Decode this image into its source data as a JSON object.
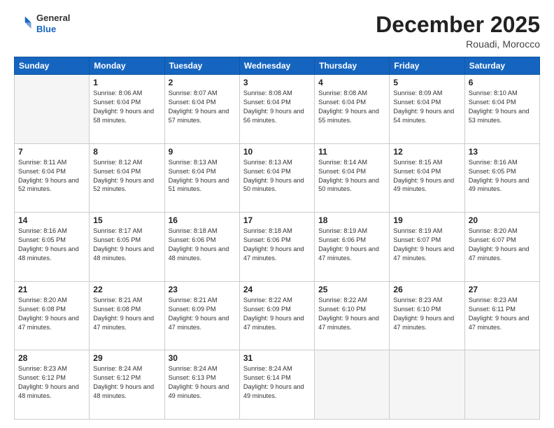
{
  "logo": {
    "general": "General",
    "blue": "Blue"
  },
  "header": {
    "month": "December 2025",
    "location": "Rouadi, Morocco"
  },
  "days_of_week": [
    "Sunday",
    "Monday",
    "Tuesday",
    "Wednesday",
    "Thursday",
    "Friday",
    "Saturday"
  ],
  "weeks": [
    [
      {
        "day": "",
        "empty": true
      },
      {
        "day": "1",
        "sunrise": "8:06 AM",
        "sunset": "6:04 PM",
        "daylight": "9 hours and 58 minutes."
      },
      {
        "day": "2",
        "sunrise": "8:07 AM",
        "sunset": "6:04 PM",
        "daylight": "9 hours and 57 minutes."
      },
      {
        "day": "3",
        "sunrise": "8:08 AM",
        "sunset": "6:04 PM",
        "daylight": "9 hours and 56 minutes."
      },
      {
        "day": "4",
        "sunrise": "8:08 AM",
        "sunset": "6:04 PM",
        "daylight": "9 hours and 55 minutes."
      },
      {
        "day": "5",
        "sunrise": "8:09 AM",
        "sunset": "6:04 PM",
        "daylight": "9 hours and 54 minutes."
      },
      {
        "day": "6",
        "sunrise": "8:10 AM",
        "sunset": "6:04 PM",
        "daylight": "9 hours and 53 minutes."
      }
    ],
    [
      {
        "day": "7",
        "sunrise": "8:11 AM",
        "sunset": "6:04 PM",
        "daylight": "9 hours and 52 minutes."
      },
      {
        "day": "8",
        "sunrise": "8:12 AM",
        "sunset": "6:04 PM",
        "daylight": "9 hours and 52 minutes."
      },
      {
        "day": "9",
        "sunrise": "8:13 AM",
        "sunset": "6:04 PM",
        "daylight": "9 hours and 51 minutes."
      },
      {
        "day": "10",
        "sunrise": "8:13 AM",
        "sunset": "6:04 PM",
        "daylight": "9 hours and 50 minutes."
      },
      {
        "day": "11",
        "sunrise": "8:14 AM",
        "sunset": "6:04 PM",
        "daylight": "9 hours and 50 minutes."
      },
      {
        "day": "12",
        "sunrise": "8:15 AM",
        "sunset": "6:04 PM",
        "daylight": "9 hours and 49 minutes."
      },
      {
        "day": "13",
        "sunrise": "8:16 AM",
        "sunset": "6:05 PM",
        "daylight": "9 hours and 49 minutes."
      }
    ],
    [
      {
        "day": "14",
        "sunrise": "8:16 AM",
        "sunset": "6:05 PM",
        "daylight": "9 hours and 48 minutes."
      },
      {
        "day": "15",
        "sunrise": "8:17 AM",
        "sunset": "6:05 PM",
        "daylight": "9 hours and 48 minutes."
      },
      {
        "day": "16",
        "sunrise": "8:18 AM",
        "sunset": "6:06 PM",
        "daylight": "9 hours and 48 minutes."
      },
      {
        "day": "17",
        "sunrise": "8:18 AM",
        "sunset": "6:06 PM",
        "daylight": "9 hours and 47 minutes."
      },
      {
        "day": "18",
        "sunrise": "8:19 AM",
        "sunset": "6:06 PM",
        "daylight": "9 hours and 47 minutes."
      },
      {
        "day": "19",
        "sunrise": "8:19 AM",
        "sunset": "6:07 PM",
        "daylight": "9 hours and 47 minutes."
      },
      {
        "day": "20",
        "sunrise": "8:20 AM",
        "sunset": "6:07 PM",
        "daylight": "9 hours and 47 minutes."
      }
    ],
    [
      {
        "day": "21",
        "sunrise": "8:20 AM",
        "sunset": "6:08 PM",
        "daylight": "9 hours and 47 minutes."
      },
      {
        "day": "22",
        "sunrise": "8:21 AM",
        "sunset": "6:08 PM",
        "daylight": "9 hours and 47 minutes."
      },
      {
        "day": "23",
        "sunrise": "8:21 AM",
        "sunset": "6:09 PM",
        "daylight": "9 hours and 47 minutes."
      },
      {
        "day": "24",
        "sunrise": "8:22 AM",
        "sunset": "6:09 PM",
        "daylight": "9 hours and 47 minutes."
      },
      {
        "day": "25",
        "sunrise": "8:22 AM",
        "sunset": "6:10 PM",
        "daylight": "9 hours and 47 minutes."
      },
      {
        "day": "26",
        "sunrise": "8:23 AM",
        "sunset": "6:10 PM",
        "daylight": "9 hours and 47 minutes."
      },
      {
        "day": "27",
        "sunrise": "8:23 AM",
        "sunset": "6:11 PM",
        "daylight": "9 hours and 47 minutes."
      }
    ],
    [
      {
        "day": "28",
        "sunrise": "8:23 AM",
        "sunset": "6:12 PM",
        "daylight": "9 hours and 48 minutes."
      },
      {
        "day": "29",
        "sunrise": "8:24 AM",
        "sunset": "6:12 PM",
        "daylight": "9 hours and 48 minutes."
      },
      {
        "day": "30",
        "sunrise": "8:24 AM",
        "sunset": "6:13 PM",
        "daylight": "9 hours and 49 minutes."
      },
      {
        "day": "31",
        "sunrise": "8:24 AM",
        "sunset": "6:14 PM",
        "daylight": "9 hours and 49 minutes."
      },
      {
        "day": "",
        "empty": true
      },
      {
        "day": "",
        "empty": true
      },
      {
        "day": "",
        "empty": true
      }
    ]
  ]
}
